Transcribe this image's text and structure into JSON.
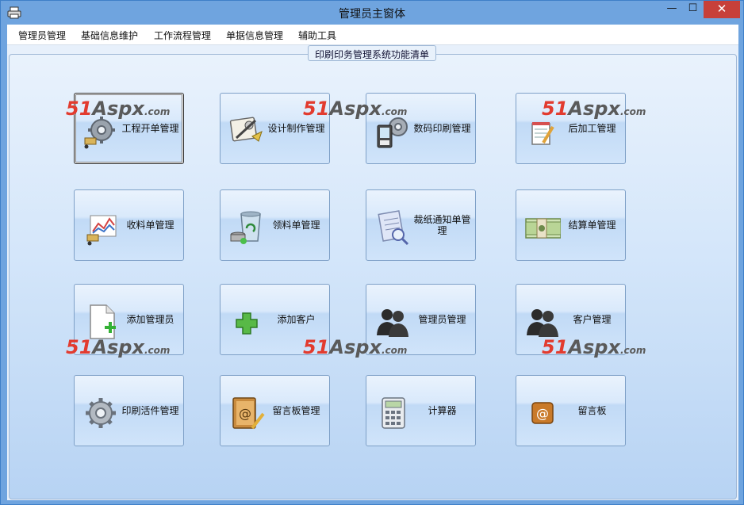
{
  "window": {
    "title": "管理员主窗体",
    "minimize_symbol": "—",
    "maximize_symbol": "☐",
    "close_symbol": "✕"
  },
  "menu": [
    {
      "label": "管理员管理"
    },
    {
      "label": "基础信息维护"
    },
    {
      "label": "工作流程管理"
    },
    {
      "label": "单据信息管理"
    },
    {
      "label": "辅助工具"
    }
  ],
  "group": {
    "caption": "印刷印务管理系统功能清单"
  },
  "tiles": [
    {
      "label": "工程开单管理",
      "icon": "gear-cart-icon",
      "selected": true
    },
    {
      "label": "设计制作管理",
      "icon": "design-tools-icon"
    },
    {
      "label": "数码印刷管理",
      "icon": "phone-gear-icon"
    },
    {
      "label": "后加工管理",
      "icon": "notepad-pen-icon"
    },
    {
      "label": "收料单管理",
      "icon": "chart-cart-icon"
    },
    {
      "label": "领料单管理",
      "icon": "recycle-bin-icon"
    },
    {
      "label": "裁纸通知单管理",
      "icon": "notebook-magnifier-icon"
    },
    {
      "label": "结算单管理",
      "icon": "money-stack-icon"
    },
    {
      "label": "添加管理员",
      "icon": "document-add-icon"
    },
    {
      "label": "添加客户",
      "icon": "green-plus-icon"
    },
    {
      "label": "管理员管理",
      "icon": "users-icon"
    },
    {
      "label": "客户管理",
      "icon": "users-icon"
    },
    {
      "label": "印刷活件管理",
      "icon": "gear-icon"
    },
    {
      "label": "留言板管理",
      "icon": "address-book-pen-icon"
    },
    {
      "label": "计算器",
      "icon": "calculator-icon"
    },
    {
      "label": "留言板",
      "icon": "at-sign-icon"
    }
  ],
  "watermark": {
    "number": "51",
    "brand": "Aspx",
    "suffix": ".com"
  },
  "colors": {
    "titlebar": "#6fa4df",
    "close_button": "#c7403a",
    "watermark_red": "#e23b2f"
  }
}
